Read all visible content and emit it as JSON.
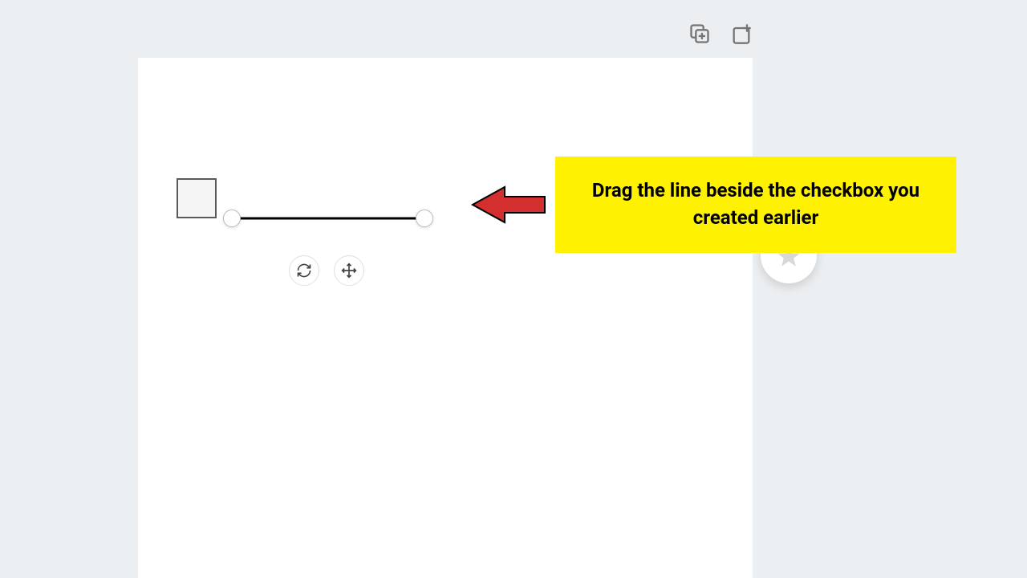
{
  "callout": {
    "text": "Drag the line beside the checkbox you created earlier"
  },
  "colors": {
    "callout_bg": "#fff200",
    "arrow_fill": "#d32f2f",
    "canvas_bg": "#ffffff",
    "page_bg": "#eceff1"
  }
}
